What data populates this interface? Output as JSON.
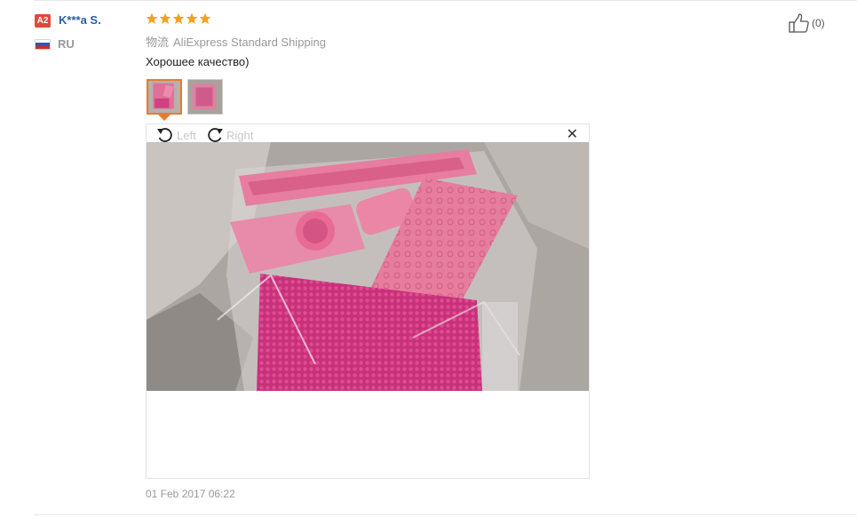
{
  "user": {
    "level_badge": "A2",
    "name": "K***a S.",
    "country": "RU"
  },
  "colors": {
    "badge": "#e2483d",
    "star": "#f6a020",
    "active_thumb": "#e87a2e",
    "name": "#2a5ea5"
  },
  "review": {
    "rating": 5,
    "shipping_label": "物流",
    "shipping_value": "AliExpress Standard Shipping",
    "text": "Хорошее качество)",
    "date": "01 Feb 2017 06:22"
  },
  "viewer": {
    "rotate_left_label": "Left",
    "rotate_right_label": "Right",
    "close_icon": "close-icon"
  },
  "helpful": {
    "count_text": "(0)"
  }
}
